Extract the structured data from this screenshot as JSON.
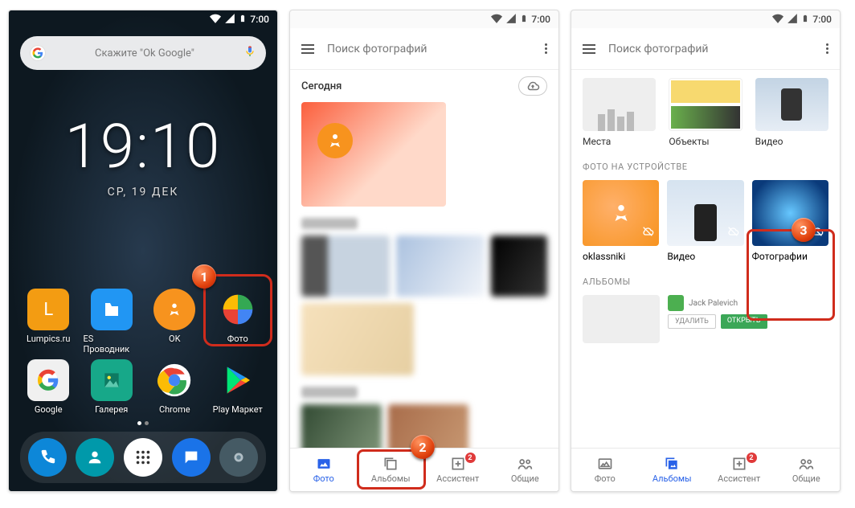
{
  "status": {
    "time": "7:00"
  },
  "home": {
    "search_hint": "Скажите \"Ok Google\"",
    "clock": "19:10",
    "date": "СР, 19 ДЕК",
    "apps": [
      {
        "name": "Lumpics.ru"
      },
      {
        "name": "ES Проводник"
      },
      {
        "name": "OK"
      },
      {
        "name": "Фото"
      },
      {
        "name": "Google"
      },
      {
        "name": "Галерея"
      },
      {
        "name": "Chrome"
      },
      {
        "name": "Play Маркет"
      }
    ],
    "marker": "1"
  },
  "photos_feed": {
    "search_placeholder": "Поиск фотографий",
    "section_today": "Сегодня",
    "marker": "2"
  },
  "photos_albums": {
    "search_placeholder": "Поиск фотографий",
    "categories": [
      {
        "label": "Места"
      },
      {
        "label": "Объекты"
      },
      {
        "label": "Видео"
      }
    ],
    "device_title": "ФОТО НА УСТРОЙСТВЕ",
    "device_folders": [
      {
        "label": "oklassniki"
      },
      {
        "label": "Видео"
      },
      {
        "label": "Фотографии"
      }
    ],
    "albums_title": "АЛЬБОМЫ",
    "album_author": "Jack Palevich",
    "album_btn_delete": "УДАЛИТЬ",
    "album_btn_open": "ОТКРЫТЬ",
    "marker": "3"
  },
  "nav": {
    "photo": "Фото",
    "albums": "Альбомы",
    "assistant": "Ассистент",
    "shared": "Общие",
    "assistant_count": "2"
  }
}
